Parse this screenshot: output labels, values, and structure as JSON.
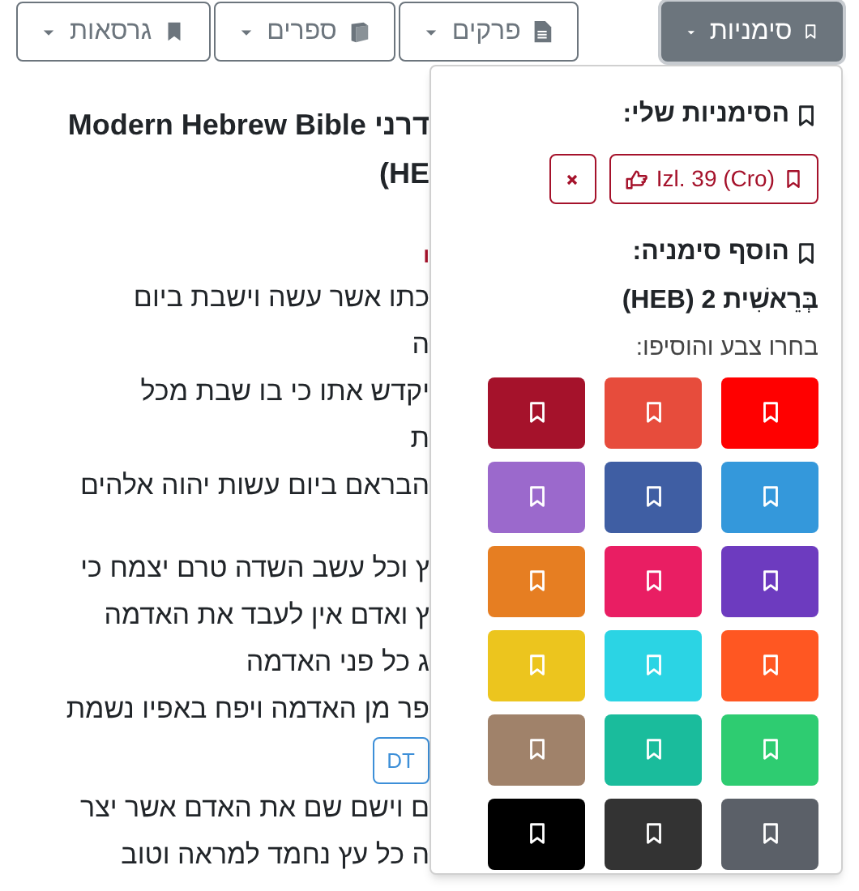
{
  "toolbar": [
    {
      "label": "סימניות",
      "selected": true
    },
    {
      "label": "פרקים",
      "selected": false
    },
    {
      "label": "ספרים",
      "selected": false
    },
    {
      "label": "גרסאות",
      "selected": false
    }
  ],
  "title_lines": [
    "Modern Hebrew Bible דרני",
    "(HE"
  ],
  "chapter_mark": "ו",
  "verses": [
    {
      "lines": [
        "כתו אשר עשה וישבת ביום",
        "ה"
      ]
    },
    {
      "lines": [
        "יקדש אתו כי בו שבת מכל",
        "ת"
      ]
    },
    {
      "lines": [
        "הבראם ביום עשות יהוה אלהים"
      ]
    },
    {
      "lines": [
        "ץ וכל עשב השדה טרם יצמח כי",
        "ץ ואדם אין לעבד את האדמה",
        "ג כל פני האדמה"
      ]
    },
    {
      "lines": [
        "פר מן האדמה ויפח באפיו נשמת"
      ],
      "tag": "DT"
    },
    {
      "lines": [
        "ם וישם שם את האדם אשר יצר",
        "ה כל עץ נחמד למראה וטוב"
      ]
    }
  ],
  "bookmarks_panel": {
    "heading": "הסימניות שלי:",
    "saved": [
      {
        "label": "Izl. 39 (Cro)"
      }
    ],
    "add_heading": "הוסף סימניה:",
    "reference": "בְּרֵאשִׁית 2 (HEB)",
    "hint": "בחרו צבע והוסיפו:",
    "colors": [
      {
        "color": "#ff0000"
      },
      {
        "color": "#e74c3c"
      },
      {
        "color": "#a5122b"
      },
      {
        "color": "#3498db"
      },
      {
        "color": "#3f5ea3"
      },
      {
        "color": "#9b69cc"
      },
      {
        "color": "#6d3bbf"
      },
      {
        "color": "#e91e63"
      },
      {
        "color": "#e67e22"
      },
      {
        "color": "#ff5722"
      },
      {
        "color": "#2bd4e4"
      },
      {
        "color": "#ecc51e"
      },
      {
        "color": "#2ecc71"
      },
      {
        "color": "#1abc9c"
      },
      {
        "color": "#a0826a"
      },
      {
        "color": "#5b6068"
      },
      {
        "color": "#333333"
      },
      {
        "color": "#000000"
      }
    ]
  }
}
